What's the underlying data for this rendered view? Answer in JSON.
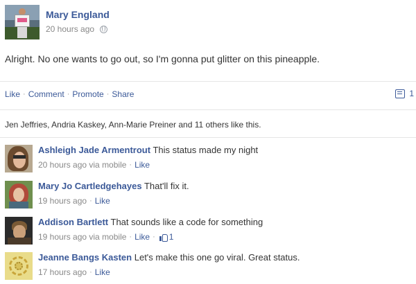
{
  "post": {
    "author_name": "Mary England",
    "timestamp": "20 hours ago",
    "privacy_icon": "globe-icon",
    "status_text": "Alright. No one wants to go out, so I'm gonna put glitter on this pineapple."
  },
  "actions": {
    "like": "Like",
    "comment": "Comment",
    "promote": "Promote",
    "share": "Share",
    "separator": "·",
    "comment_count": "1"
  },
  "likes_summary": "Jen Jeffries, Andria Kaskey, Ann-Marie Preiner and 11 others like this.",
  "comments": [
    {
      "name": "Ashleigh Jade Armentrout",
      "text": "This status made my night",
      "time": "20 hours ago via mobile",
      "like_label": "Like"
    },
    {
      "name": "Mary Jo Cartledgehayes",
      "text": "That'll fix it.",
      "time": "19 hours ago",
      "like_label": "Like"
    },
    {
      "name": "Addison Bartlett",
      "text": "That sounds like a code for something",
      "time": "19 hours ago via mobile",
      "like_label": "Like",
      "like_count": "1"
    },
    {
      "name": "Jeanne Bangs Kasten",
      "text": "Let's make this one go viral. Great status.",
      "time": "17 hours ago",
      "like_label": "Like"
    }
  ],
  "colors": {
    "link": "#3b5998",
    "text": "#333333",
    "muted": "#888888",
    "divider": "#e5e5e5"
  }
}
